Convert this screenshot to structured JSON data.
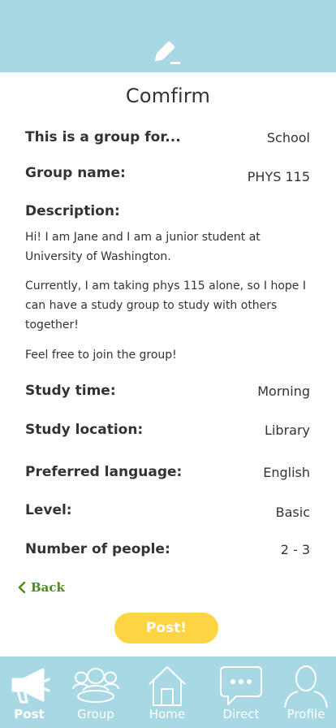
{
  "header": {
    "icon": "edit-pencil-icon"
  },
  "page": {
    "title": "Comfirm"
  },
  "fields": {
    "group_type": {
      "label": "This is a group for...",
      "value": "School"
    },
    "group_name": {
      "label": "Group name:",
      "value": "PHYS 115"
    },
    "description": {
      "label": "Description:",
      "paragraphs": [
        "Hi! I am Jane and I am a junior student at University of Washington.",
        "Currently, I am taking phys 115 alone, so I hope I can have a study group to study with others together!",
        "Feel free to join the group!"
      ]
    },
    "study_time": {
      "label": "Study time:",
      "value": "Morning"
    },
    "study_location": {
      "label": "Study location:",
      "value": "Library"
    },
    "preferred_language": {
      "label": "Preferred language:",
      "value": "English"
    },
    "level": {
      "label": "Level:",
      "value": "Basic"
    },
    "number_of_people": {
      "label": "Number of people:",
      "value": "2 - 3"
    }
  },
  "actions": {
    "back_label": "Back",
    "post_label": "Post!"
  },
  "nav": {
    "items": [
      {
        "label": "Post",
        "icon": "megaphone-icon",
        "active": true
      },
      {
        "label": "Group",
        "icon": "group-icon",
        "active": false
      },
      {
        "label": "Home",
        "icon": "home-icon",
        "active": false
      },
      {
        "label": "Direct",
        "icon": "chat-bubble-icon",
        "active": false
      },
      {
        "label": "Profile",
        "icon": "user-icon",
        "active": false
      }
    ]
  },
  "colors": {
    "bar": "#a8d8e4",
    "accent_yellow": "#fcd444",
    "back_green": "#4a8c1c",
    "text": "#333333"
  }
}
